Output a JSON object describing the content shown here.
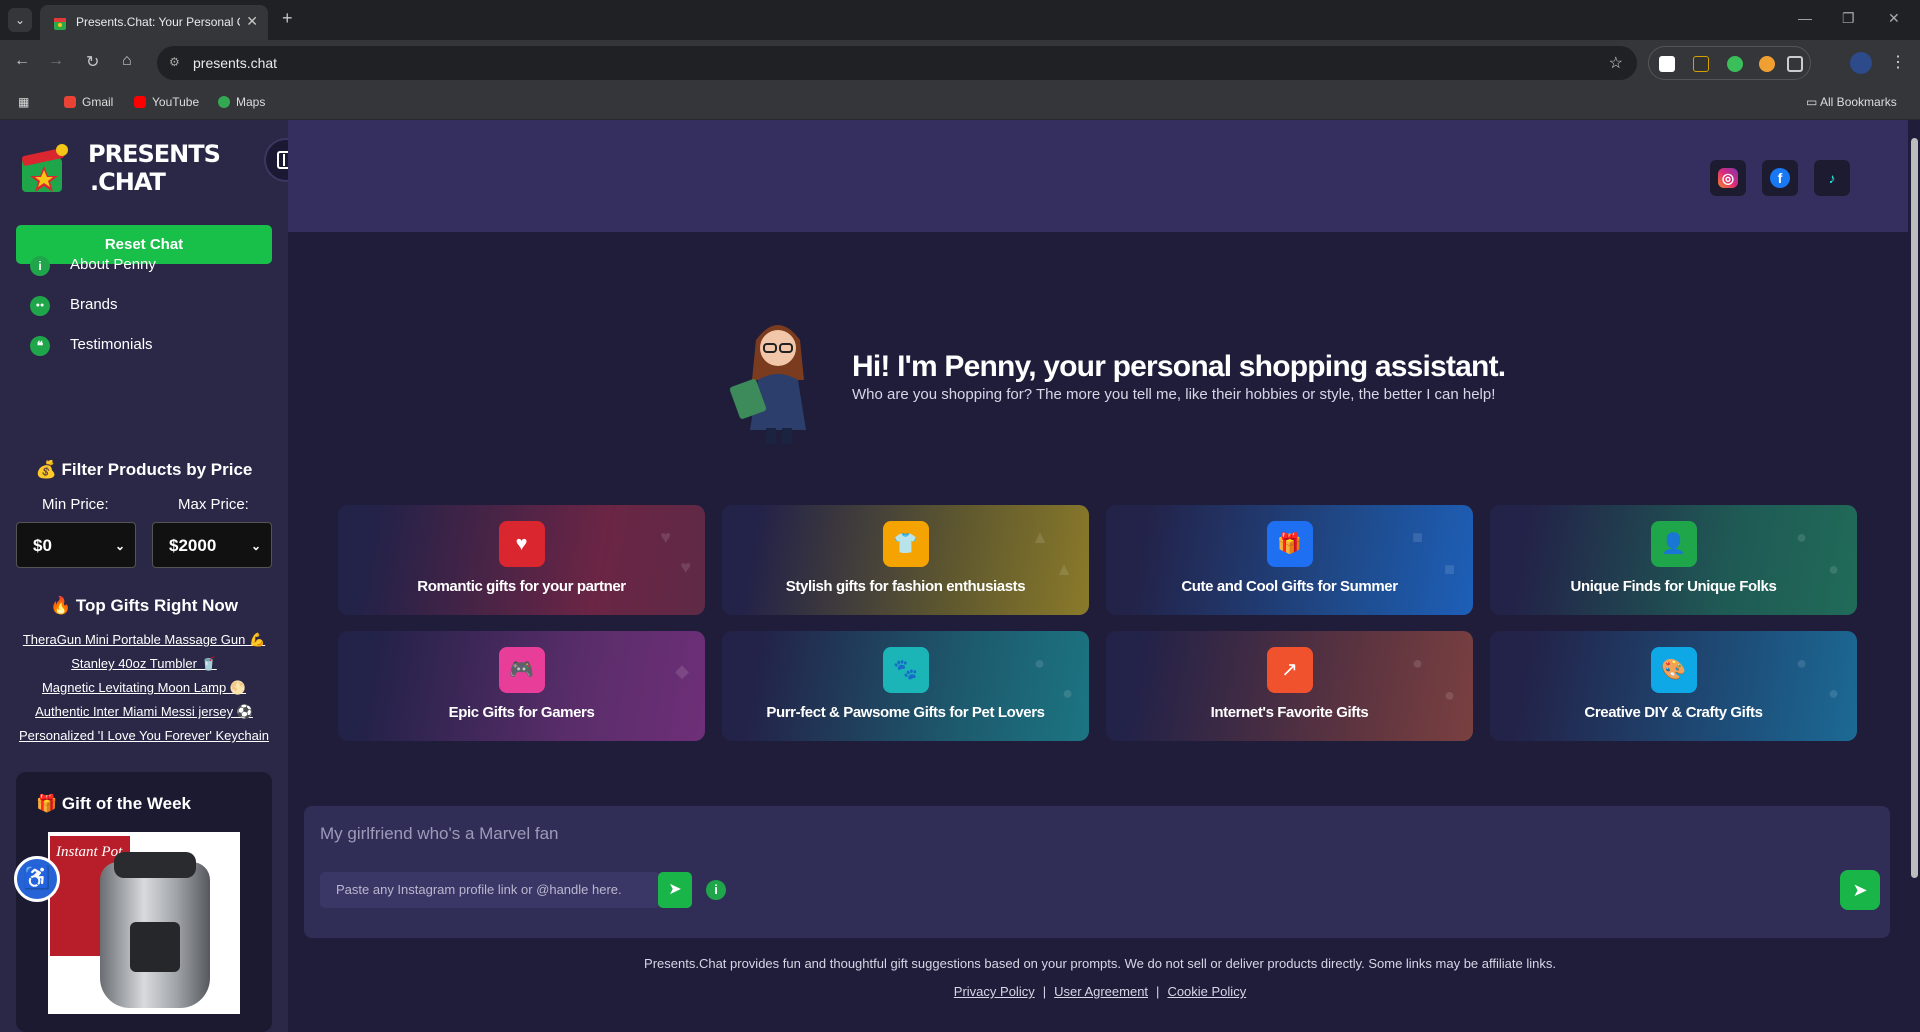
{
  "browser": {
    "tab_title": "Presents.Chat: Your Personal Gi",
    "url": "presents.chat",
    "bookmarks": [
      "Gmail",
      "YouTube",
      "Maps"
    ],
    "all_bookmarks": "All Bookmarks"
  },
  "sidebar": {
    "logo_line1": "PRESENTS",
    "logo_line2": ".CHAT",
    "reset_label": "Reset Chat",
    "nav": [
      {
        "label": "About Penny",
        "icon": "info-icon"
      },
      {
        "label": "Brands",
        "icon": "brands-icon"
      },
      {
        "label": "Testimonials",
        "icon": "chat-bubble-icon"
      }
    ],
    "filter_title": "💰 Filter Products by Price",
    "min_label": "Min Price:",
    "max_label": "Max Price:",
    "min_value": "$0",
    "max_value": "$2000",
    "top_title": "🔥 Top Gifts Right Now",
    "top_gifts": [
      "TheraGun Mini Portable Massage Gun 💪",
      "Stanley 40oz Tumbler 🥤",
      "Magnetic Levitating Moon Lamp 🌕",
      "Authentic Inter Miami Messi jersey ⚽",
      "Personalized 'I Love You Forever' Keychain"
    ],
    "gotw_title": "🎁 Gift of the Week",
    "gotw_brand": "Instant Pot"
  },
  "hero": {
    "title": "Hi! I'm Penny, your personal shopping assistant.",
    "subtitle": "Who are you shopping for? The more you tell me, like their hobbies or style, the better I can help!"
  },
  "cards": [
    {
      "label": "Romantic gifts for your partner",
      "icon": "heart-icon",
      "color": "#d9262f"
    },
    {
      "label": "Stylish gifts for fashion enthusiasts",
      "icon": "shirt-icon",
      "color": "#f5a300"
    },
    {
      "label": "Cute and Cool Gifts for Summer",
      "icon": "gift-icon",
      "color": "#1f6ff2"
    },
    {
      "label": "Unique Finds for Unique Folks",
      "icon": "user-icon",
      "color": "#1fa64a"
    },
    {
      "label": "Epic Gifts for Gamers",
      "icon": "gamepad-icon",
      "color": "#e83e9a"
    },
    {
      "label": "Purr-fect & Pawsome Gifts for Pet Lovers",
      "icon": "paw-icon",
      "color": "#1bb5b8"
    },
    {
      "label": "Internet's Favorite Gifts",
      "icon": "trend-icon",
      "color": "#f0522e"
    },
    {
      "label": "Creative DIY & Crafty Gifts",
      "icon": "palette-icon",
      "color": "#0fa8e6"
    }
  ],
  "composer": {
    "placeholder": "My girlfriend who's a Marvel fan",
    "ig_placeholder": "Paste any Instagram profile link or @handle here."
  },
  "footer": {
    "disclaimer": "Presents.Chat provides fun and thoughtful gift suggestions based on your prompts. We do not sell or deliver products directly. Some links may be affiliate links.",
    "links": [
      "Privacy Policy",
      "User Agreement",
      "Cookie Policy"
    ]
  }
}
